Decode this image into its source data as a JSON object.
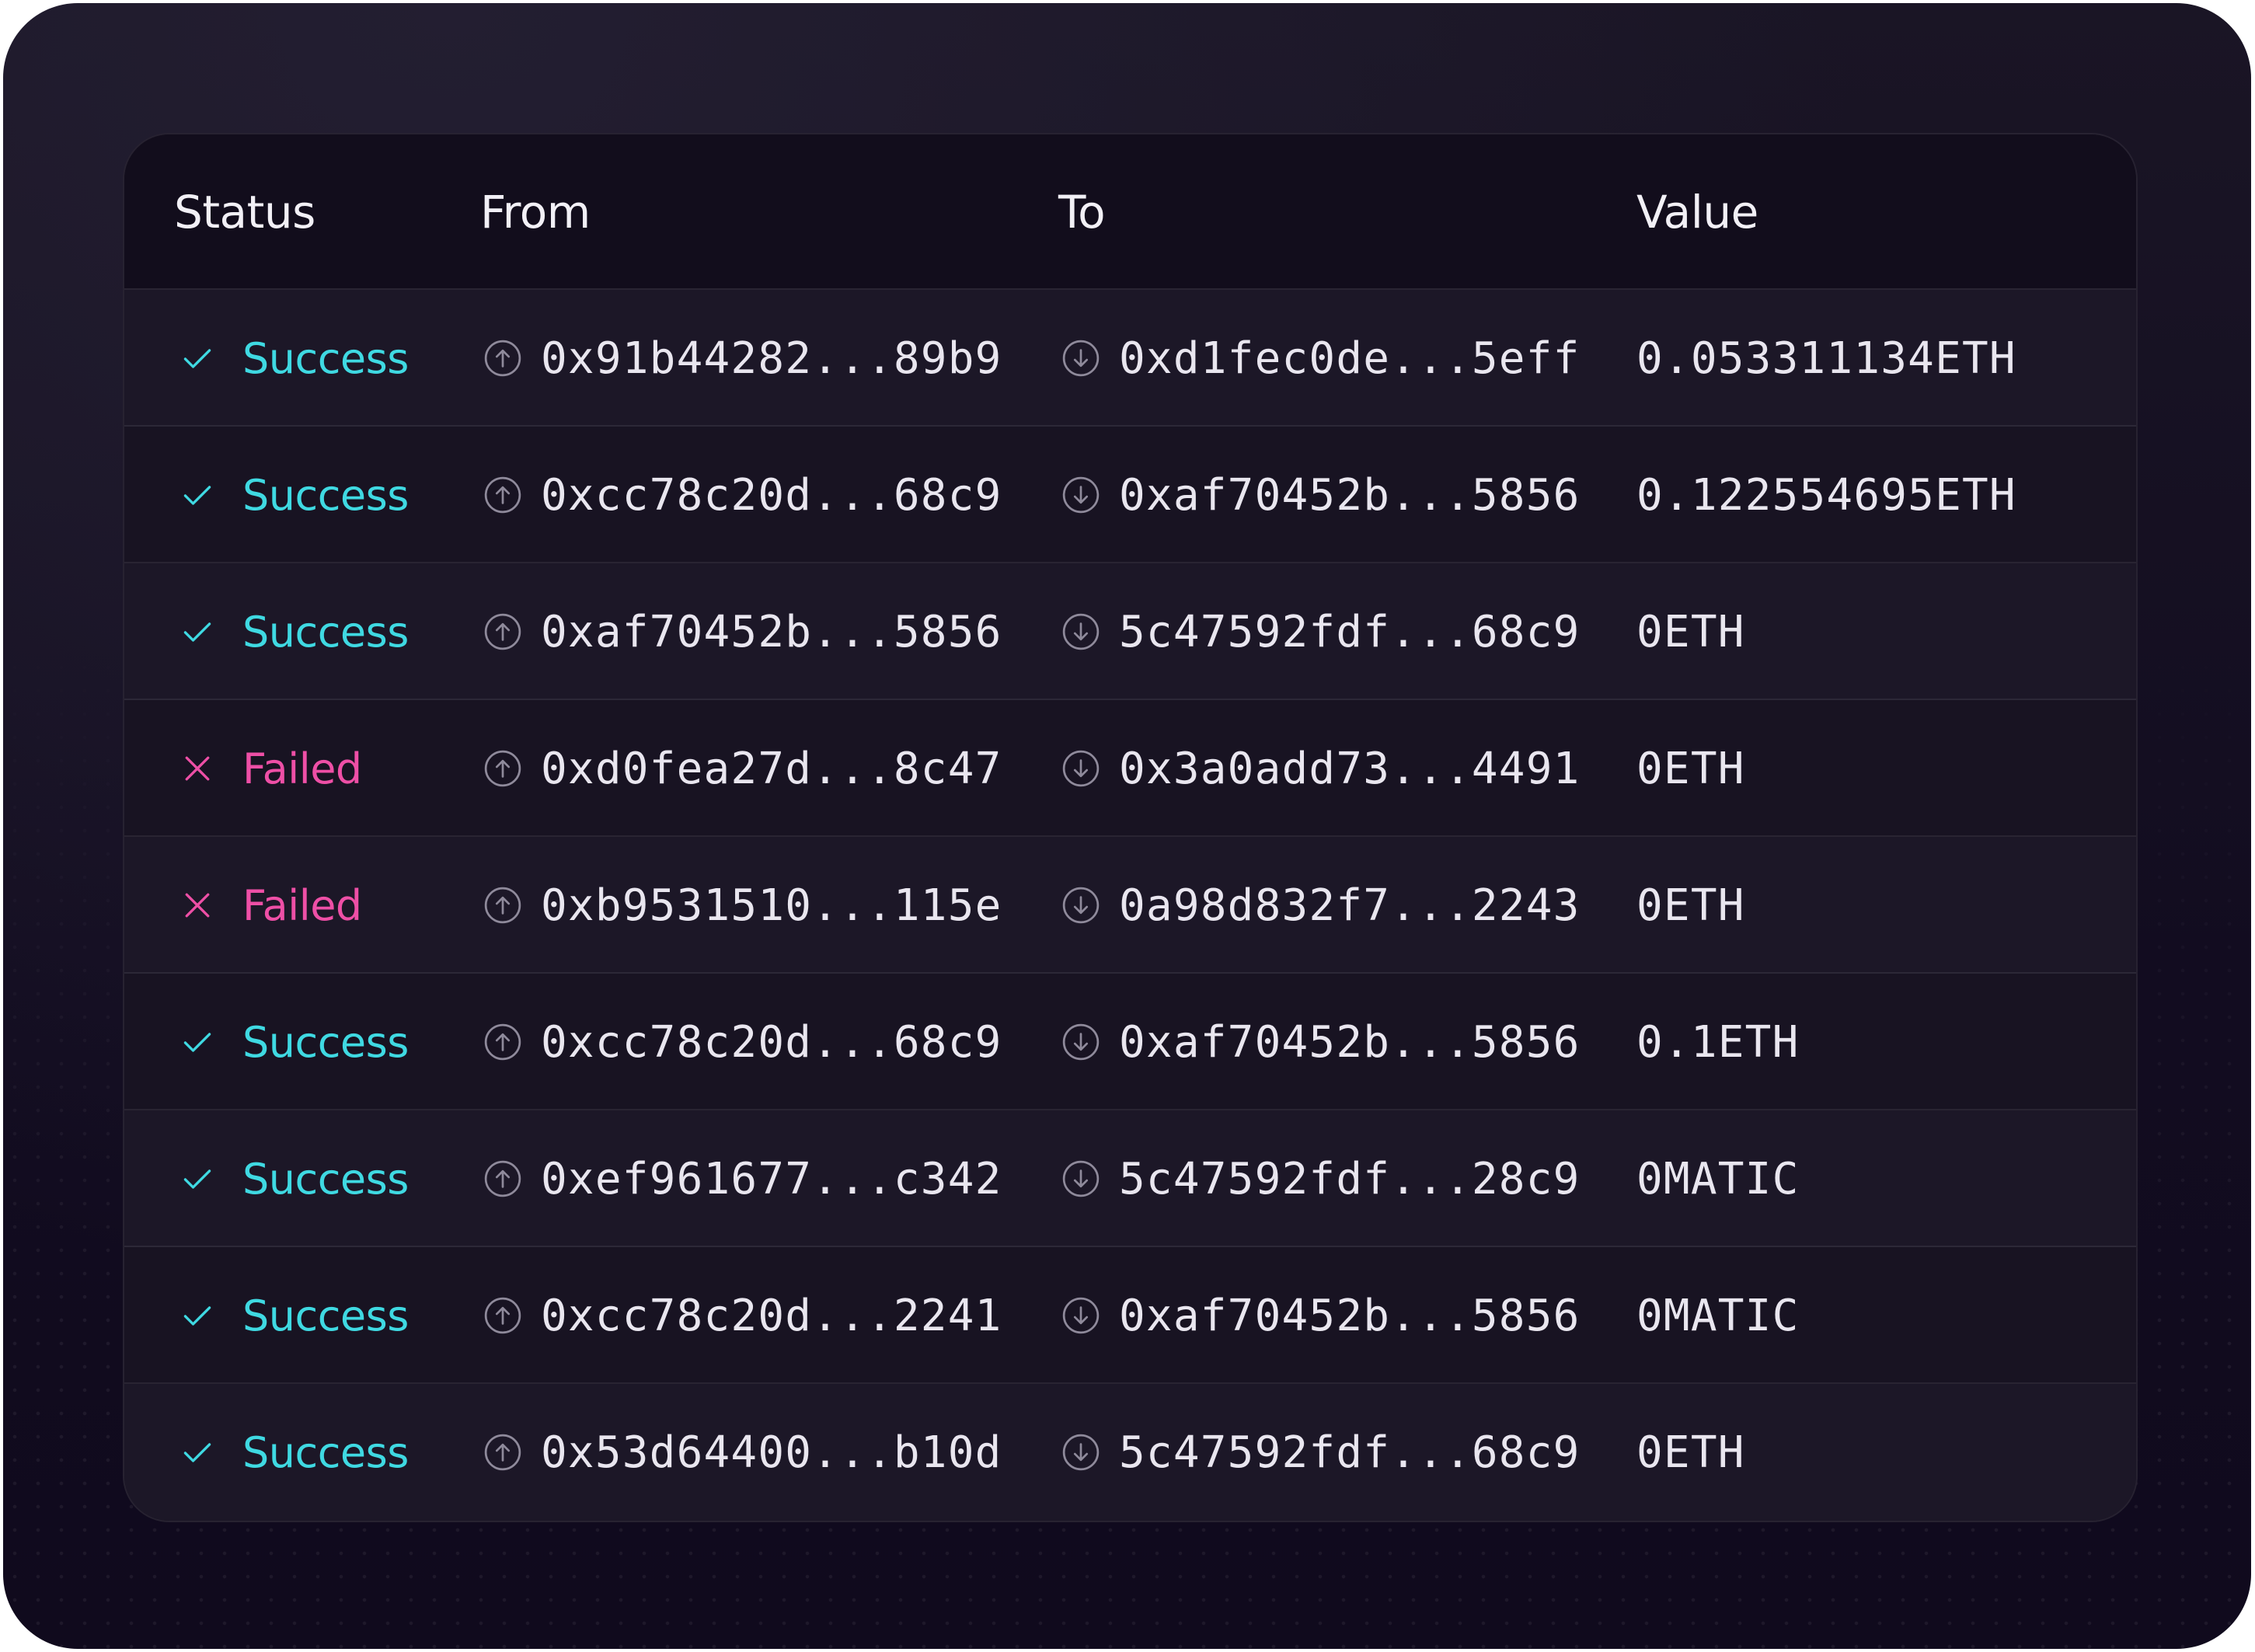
{
  "colors": {
    "success": "#3fd9e2",
    "failed": "#ee4fa6",
    "text": "#e9e6ef",
    "background": "#120c20"
  },
  "table": {
    "headers": {
      "status": "Status",
      "from": "From",
      "to": "To",
      "value": "Value"
    },
    "rows": [
      {
        "status": "Success",
        "status_kind": "success",
        "from": "0x91b44282...89b9",
        "to": "0xd1fec0de...5eff",
        "value": "0.053311134ETH"
      },
      {
        "status": "Success",
        "status_kind": "success",
        "from": "0xcc78c20d...68c9",
        "to": "0xaf70452b...5856",
        "value": "0.122554695ETH"
      },
      {
        "status": "Success",
        "status_kind": "success",
        "from": "0xaf70452b...5856",
        "to": "5c47592fdf...68c9",
        "value": "0ETH"
      },
      {
        "status": "Failed",
        "status_kind": "failed",
        "from": "0xd0fea27d...8c47",
        "to": "0x3a0add73...4491",
        "value": "0ETH"
      },
      {
        "status": "Failed",
        "status_kind": "failed",
        "from": "0xb9531510...115e",
        "to": "0a98d832f7...2243",
        "value": "0ETH"
      },
      {
        "status": "Success",
        "status_kind": "success",
        "from": "0xcc78c20d...68c9",
        "to": "0xaf70452b...5856",
        "value": "0.1ETH"
      },
      {
        "status": "Success",
        "status_kind": "success",
        "from": "0xef961677...c342",
        "to": "5c47592fdf...28c9",
        "value": "0MATIC"
      },
      {
        "status": "Success",
        "status_kind": "success",
        "from": "0xcc78c20d...2241",
        "to": "0xaf70452b...5856",
        "value": "0MATIC"
      },
      {
        "status": "Success",
        "status_kind": "success",
        "from": "0x53d64400...b10d",
        "to": "5c47592fdf...68c9",
        "value": "0ETH"
      }
    ],
    "icons": {
      "success": "checkmark-icon",
      "failed": "x-icon",
      "from": "arrow-up-circle-icon",
      "to": "arrow-down-circle-icon"
    }
  }
}
